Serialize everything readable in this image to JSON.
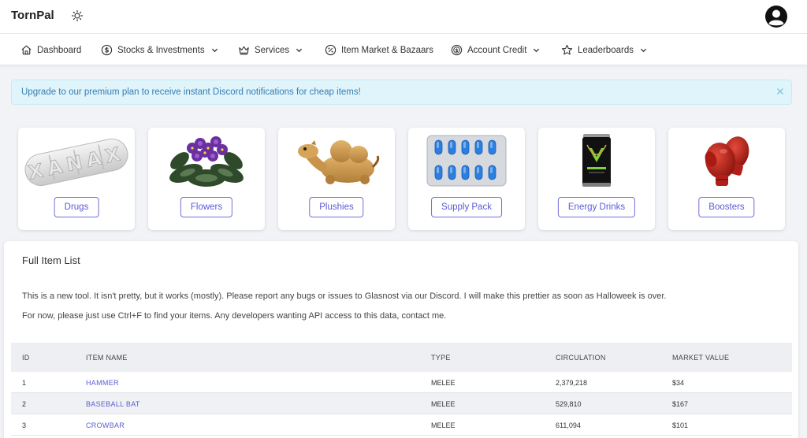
{
  "app": {
    "title": "TornPal"
  },
  "nav": {
    "items": [
      {
        "label": "Dashboard",
        "icon": "home-icon",
        "dropdown": false
      },
      {
        "label": "Stocks & Investments",
        "icon": "dollar-circle-icon",
        "dropdown": true
      },
      {
        "label": "Services",
        "icon": "crown-icon",
        "dropdown": true
      },
      {
        "label": "Item Market & Bazaars",
        "icon": "discount-icon",
        "dropdown": false
      },
      {
        "label": "Account Credit",
        "icon": "coin-icon",
        "dropdown": true
      },
      {
        "label": "Leaderboards",
        "icon": "star-icon",
        "dropdown": true
      }
    ]
  },
  "alert": {
    "text": "Upgrade to our premium plan to receive instant Discord notifications for cheap items!"
  },
  "categories": [
    {
      "label": "Drugs",
      "image": "xanax-pill"
    },
    {
      "label": "Flowers",
      "image": "african-violet"
    },
    {
      "label": "Plushies",
      "image": "camel-plushie"
    },
    {
      "label": "Supply Pack",
      "image": "blister-pack"
    },
    {
      "label": "Energy Drinks",
      "image": "energy-can"
    },
    {
      "label": "Boosters",
      "image": "boxing-gloves"
    }
  ],
  "items_panel": {
    "title": "Full Item List",
    "description1": "This is a new tool. It isn't pretty, but it works (mostly). Please report any bugs or issues to Glasnost via our Discord. I will make this prettier as soon as Halloweek is over.",
    "description2": "For now, please just use Ctrl+F to find your items. Any developers wanting API access to this data, contact me.",
    "columns": [
      "ID",
      "ITEM NAME",
      "TYPE",
      "CIRCULATION",
      "MARKET VALUE"
    ],
    "rows": [
      {
        "id": "1",
        "name": "HAMMER",
        "type": "MELEE",
        "circulation": "2,379,218",
        "value": "$34"
      },
      {
        "id": "2",
        "name": "BASEBALL BAT",
        "type": "MELEE",
        "circulation": "529,810",
        "value": "$167"
      },
      {
        "id": "3",
        "name": "CROWBAR",
        "type": "MELEE",
        "circulation": "611,094",
        "value": "$101"
      }
    ]
  },
  "colors": {
    "accent": "#5b5bd6",
    "alert_bg": "#dff4fb",
    "alert_text": "#3a7db0"
  }
}
